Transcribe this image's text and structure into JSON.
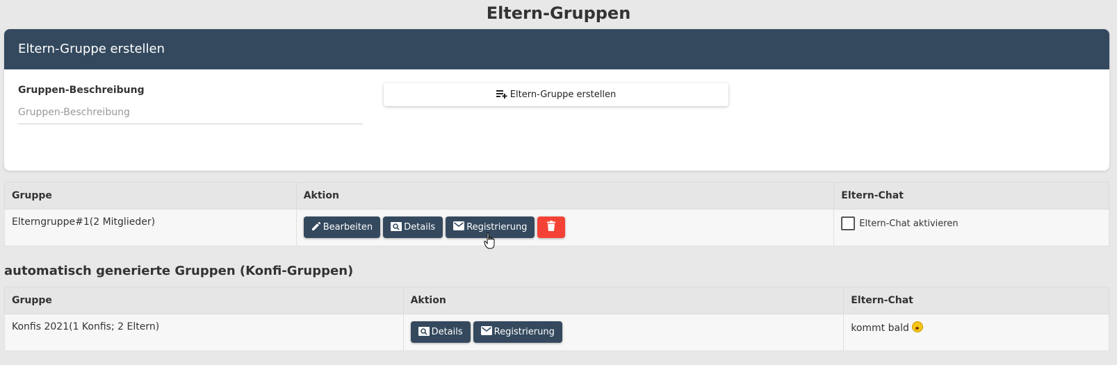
{
  "page": {
    "title": "Eltern-Gruppen"
  },
  "create_card": {
    "header": "Eltern-Gruppe erstellen",
    "field_label": "Gruppen-Beschreibung",
    "field_placeholder": "Gruppen-Beschreibung",
    "field_value": "",
    "button_label": "Eltern-Gruppe erstellen",
    "button_icon": "playlist-add-icon"
  },
  "groups_table": {
    "columns": [
      "Gruppe",
      "Aktion",
      "Eltern-Chat"
    ],
    "rows": [
      {
        "name": "Elterngruppe#1(2 Mitglieder)",
        "actions": {
          "edit_label": "Bearbeiten",
          "details_label": "Details",
          "register_label": "Registrierung",
          "delete_icon": "trash-icon"
        },
        "chat_label": "Eltern-Chat aktivieren",
        "chat_enabled": false
      }
    ]
  },
  "auto_section": {
    "title": "automatisch generierte Gruppen (Konfi-Gruppen)"
  },
  "auto_table": {
    "columns": [
      "Gruppe",
      "Aktion",
      "Eltern-Chat"
    ],
    "rows": [
      {
        "name": "Konfis 2021(1 Konfis; 2 Eltern)",
        "actions": {
          "details_label": "Details",
          "register_label": "Registrierung"
        },
        "chat_text": "kommt bald"
      }
    ]
  },
  "colors": {
    "header_bg": "#34495e",
    "button_bg": "#34495e",
    "danger": "#f44336",
    "page_bg": "#e8e8e8"
  }
}
